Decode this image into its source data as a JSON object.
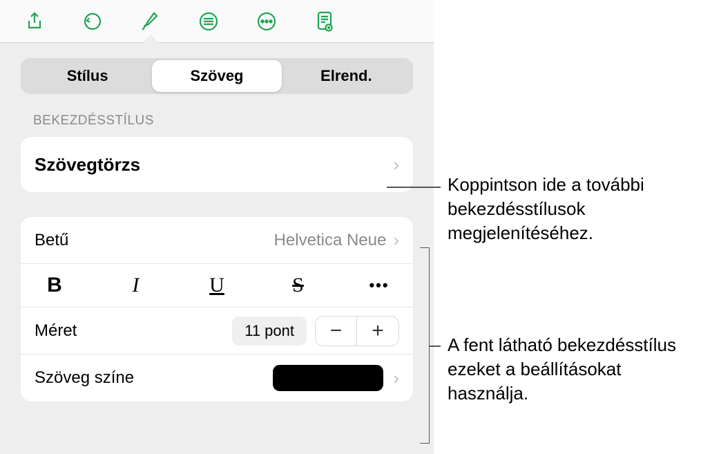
{
  "toolbar": {
    "icons": [
      "share-icon",
      "undo-icon",
      "format-brush-icon",
      "align-icon",
      "more-icon",
      "document-view-icon"
    ],
    "active_index": 2
  },
  "tabs": {
    "items": [
      "Stílus",
      "Szöveg",
      "Elrend."
    ],
    "selected_index": 1
  },
  "section_label": "BEKEZDÉSSTÍLUS",
  "paragraph_style": {
    "name": "Szövegtörzs"
  },
  "font": {
    "label": "Betű",
    "value": "Helvetica Neue"
  },
  "style_buttons": {
    "bold": "B",
    "italic": "I",
    "underline": "U",
    "strike": "S",
    "more": "•••"
  },
  "size": {
    "label": "Méret",
    "value": "11 pont",
    "minus": "−",
    "plus": "+"
  },
  "text_color": {
    "label": "Szöveg színe",
    "color": "#000000"
  },
  "callouts": {
    "top": "Koppintson ide a további bekezdésstílusok megjelenítéséhez.",
    "bottom": "A fent látható bekezdésstílus ezeket a beállításokat használja."
  }
}
